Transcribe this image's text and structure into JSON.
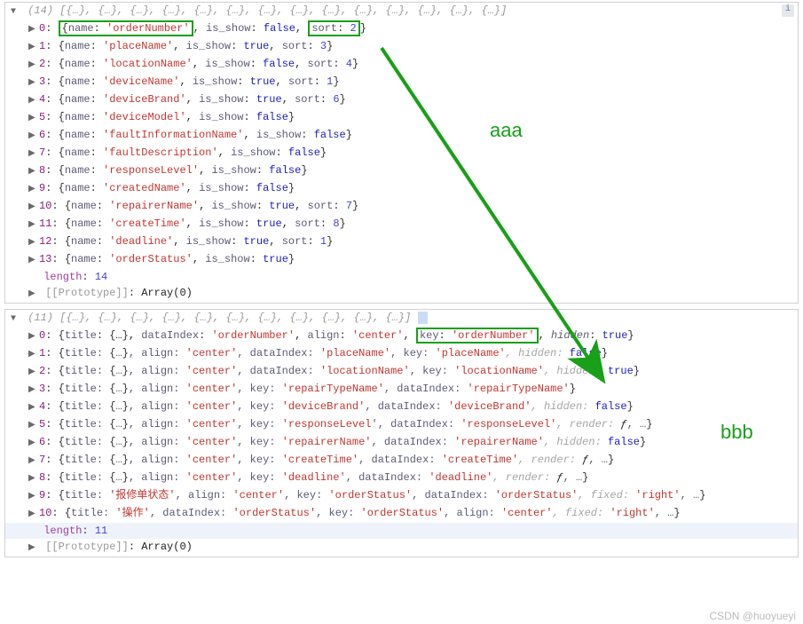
{
  "labels": {
    "aaa": "aaa",
    "bbb": "bbb"
  },
  "top": {
    "count": "14",
    "summaryPrefix": "(14)",
    "summaryItems": "[{…}, {…}, {…}, {…}, {…}, {…}, {…}, {…}, {…}, {…}, {…}, {…}, {…}, {…}]",
    "rows": [
      {
        "idx": "0",
        "name": "orderNumber",
        "is_show": "false",
        "sort": "2"
      },
      {
        "idx": "1",
        "name": "placeName",
        "is_show": "true",
        "sort": "3"
      },
      {
        "idx": "2",
        "name": "locationName",
        "is_show": "false",
        "sort": "4"
      },
      {
        "idx": "3",
        "name": "deviceName",
        "is_show": "true",
        "sort": "1"
      },
      {
        "idx": "4",
        "name": "deviceBrand",
        "is_show": "true",
        "sort": "6"
      },
      {
        "idx": "5",
        "name": "deviceModel",
        "is_show": "false"
      },
      {
        "idx": "6",
        "name": "faultInformationName",
        "is_show": "false"
      },
      {
        "idx": "7",
        "name": "faultDescription",
        "is_show": "false"
      },
      {
        "idx": "8",
        "name": "responseLevel",
        "is_show": "false"
      },
      {
        "idx": "9",
        "name": "createdName",
        "is_show": "false"
      },
      {
        "idx": "10",
        "name": "repairerName",
        "is_show": "true",
        "sort": "7"
      },
      {
        "idx": "11",
        "name": "createTime",
        "is_show": "true",
        "sort": "8"
      },
      {
        "idx": "12",
        "name": "deadline",
        "is_show": "true",
        "sort": "1"
      },
      {
        "idx": "13",
        "name": "orderStatus",
        "is_show": "true"
      }
    ],
    "lengthLabel": "length",
    "lengthVal": "14",
    "proto": "[[Prototype]]",
    "protoVal": "Array(0)"
  },
  "bottom": {
    "count": "11",
    "summaryPrefix": "(11)",
    "summaryItems": "[{…}, {…}, {…}, {…}, {…}, {…}, {…}, {…}, {…}, {…}, {…}]",
    "rows": [
      {
        "idx": "0",
        "text_pre": "{title: {…}, dataIndex: ",
        "di": "'orderNumber'",
        "mid1": ", align: ",
        "al": "'center'",
        "keyLbl": ", key: ",
        "key": "'orderNumber'",
        "post": ", hidden: ",
        "bool": "true",
        "end": "}",
        "hlKey": true,
        "italicHidden": true
      },
      {
        "idx": "1",
        "full": [
          [
            "{title: {…}, align: ",
            ""
          ],
          [
            "'center'",
            "str"
          ],
          [
            ", dataIndex: ",
            ""
          ],
          [
            "'placeName'",
            "str"
          ],
          [
            ", key: ",
            ""
          ],
          [
            "'placeName'",
            "str"
          ],
          [
            ", hidden: ",
            "dim"
          ],
          [
            "false",
            "blue"
          ],
          [
            "}",
            ""
          ]
        ]
      },
      {
        "idx": "2",
        "full": [
          [
            "{title: {…}, align: ",
            ""
          ],
          [
            "'center'",
            "str"
          ],
          [
            ", dataIndex: ",
            ""
          ],
          [
            "'locationName'",
            "str"
          ],
          [
            ", key: ",
            ""
          ],
          [
            "'locationName'",
            "str"
          ],
          [
            ", hidden: ",
            "dim"
          ],
          [
            "true",
            "blue"
          ],
          [
            "}",
            ""
          ]
        ]
      },
      {
        "idx": "3",
        "full": [
          [
            "{title: {…}, align: ",
            ""
          ],
          [
            "'center'",
            "str"
          ],
          [
            ", key: ",
            ""
          ],
          [
            "'repairTypeName'",
            "str"
          ],
          [
            ", dataIndex: ",
            ""
          ],
          [
            "'repairTypeName'",
            "str"
          ],
          [
            "}",
            ""
          ]
        ]
      },
      {
        "idx": "4",
        "full": [
          [
            "{title: {…}, align: ",
            ""
          ],
          [
            "'center'",
            "str"
          ],
          [
            ", key: ",
            ""
          ],
          [
            "'deviceBrand'",
            "str"
          ],
          [
            ", dataIndex: ",
            ""
          ],
          [
            "'deviceBrand'",
            "str"
          ],
          [
            ", hidden: ",
            "dim"
          ],
          [
            "false",
            "blue"
          ],
          [
            "}",
            ""
          ]
        ]
      },
      {
        "idx": "5",
        "full": [
          [
            "{title: {…}, align: ",
            ""
          ],
          [
            "'center'",
            "str"
          ],
          [
            ", key: ",
            ""
          ],
          [
            "'responseLevel'",
            "str"
          ],
          [
            ", dataIndex: ",
            ""
          ],
          [
            "'responseLevel'",
            "str"
          ],
          [
            ", render: ",
            "dim"
          ],
          [
            "ƒ",
            "fn"
          ],
          [
            ", …}",
            ""
          ]
        ]
      },
      {
        "idx": "6",
        "full": [
          [
            "{title: {…}, align: ",
            ""
          ],
          [
            "'center'",
            "str"
          ],
          [
            ", key: ",
            ""
          ],
          [
            "'repairerName'",
            "str"
          ],
          [
            ", dataIndex: ",
            ""
          ],
          [
            "'repairerName'",
            "str"
          ],
          [
            ", hidden: ",
            "dim"
          ],
          [
            "false",
            "blue"
          ],
          [
            "}",
            ""
          ]
        ]
      },
      {
        "idx": "7",
        "full": [
          [
            "{title: {…}, align: ",
            ""
          ],
          [
            "'center'",
            "str"
          ],
          [
            ", key: ",
            ""
          ],
          [
            "'createTime'",
            "str"
          ],
          [
            ", dataIndex: ",
            ""
          ],
          [
            "'createTime'",
            "str"
          ],
          [
            ", render: ",
            "dim"
          ],
          [
            "ƒ",
            "fn"
          ],
          [
            ", …}",
            ""
          ]
        ]
      },
      {
        "idx": "8",
        "full": [
          [
            "{title: {…}, align: ",
            ""
          ],
          [
            "'center'",
            "str"
          ],
          [
            ", key: ",
            ""
          ],
          [
            "'deadline'",
            "str"
          ],
          [
            ", dataIndex: ",
            ""
          ],
          [
            "'deadline'",
            "str"
          ],
          [
            ", render: ",
            "dim"
          ],
          [
            "ƒ",
            "fn"
          ],
          [
            ", …}",
            ""
          ]
        ]
      },
      {
        "idx": "9",
        "full": [
          [
            "{title: ",
            ""
          ],
          [
            "'报修单状态'",
            "str"
          ],
          [
            ", align: ",
            ""
          ],
          [
            "'center'",
            "str"
          ],
          [
            ", key: ",
            ""
          ],
          [
            "'orderStatus'",
            "str"
          ],
          [
            ", dataIndex: ",
            ""
          ],
          [
            "'orderStatus'",
            "str"
          ],
          [
            ", fixed: ",
            "dim"
          ],
          [
            "'right'",
            "str"
          ],
          [
            ", …}",
            ""
          ]
        ]
      },
      {
        "idx": "10",
        "full": [
          [
            "{title: ",
            ""
          ],
          [
            "'操作'",
            "str"
          ],
          [
            ", dataIndex: ",
            ""
          ],
          [
            "'orderStatus'",
            "str"
          ],
          [
            ", key: ",
            ""
          ],
          [
            "'orderStatus'",
            "str"
          ],
          [
            ", align: ",
            ""
          ],
          [
            "'center'",
            "str"
          ],
          [
            ", fixed: ",
            "dim"
          ],
          [
            "'right'",
            "str"
          ],
          [
            ", …}",
            ""
          ]
        ]
      }
    ],
    "lengthLabel": "length",
    "lengthVal": "11",
    "proto": "[[Prototype]]",
    "protoVal": "Array(0)"
  },
  "watermark": "CSDN @huoyueyi"
}
